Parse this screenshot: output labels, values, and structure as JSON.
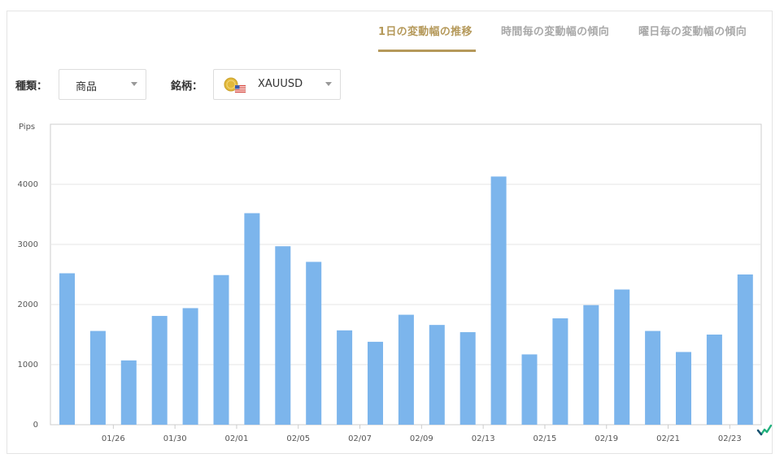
{
  "tabs": [
    {
      "label": "1日の変動幅の推移",
      "active": true
    },
    {
      "label": "時間毎の変動幅の傾向",
      "active": false
    },
    {
      "label": "曜日毎の変動幅の傾向",
      "active": false
    }
  ],
  "filters": {
    "type_label": "種類：",
    "type_value": "商品",
    "symbol_label": "銘柄：",
    "symbol_value": "XAUUSD",
    "symbol_icon": "gold-coin-us-flag-icon"
  },
  "colors": {
    "accent": "#b5995a",
    "bar": "#7cb5ec",
    "tab_inactive": "#a8a8a8"
  },
  "chart_data": {
    "type": "bar",
    "ylabel": "Pips",
    "ylim": [
      0,
      5000
    ],
    "yticks": [
      0,
      1000,
      2000,
      3000,
      4000
    ],
    "xtick_labels": [
      "01/26",
      "01/30",
      "02/01",
      "02/05",
      "02/07",
      "02/09",
      "02/13",
      "02/15",
      "02/19",
      "02/21",
      "02/23"
    ],
    "values": [
      2520,
      1560,
      1070,
      1810,
      1940,
      2490,
      3520,
      2970,
      2710,
      1570,
      1380,
      1830,
      1660,
      1540,
      4130,
      1170,
      1770,
      1990,
      2250,
      1560,
      1210,
      1500,
      2500
    ],
    "grid": true,
    "legend": "none"
  }
}
